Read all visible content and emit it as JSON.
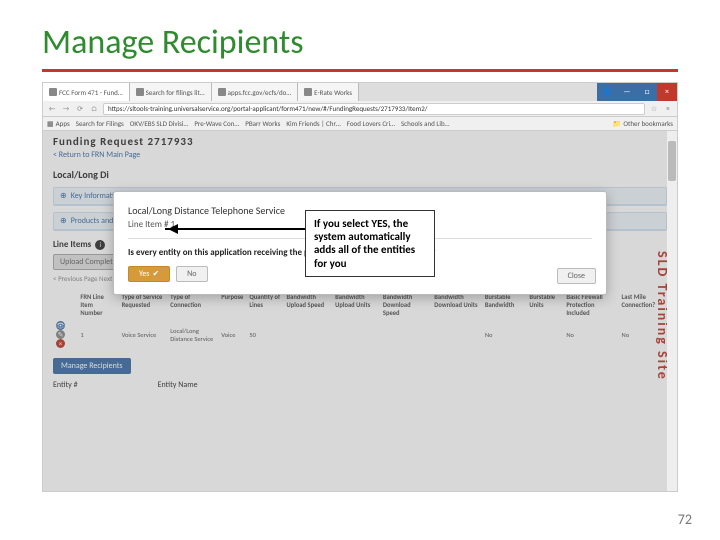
{
  "slide": {
    "title": "Manage Recipients",
    "page_num": "72"
  },
  "callout": {
    "text": "If you select YES, the system automatically adds all of the entities for you"
  },
  "browser": {
    "tabs": [
      "FCC Form 471 - Fund…",
      "Search for filings lit…",
      "apps.fcc.gov/ecfs/do…",
      "E-Rate Works"
    ],
    "url": "https://sltools-training.universalservice.org/portal-applicant/form471/new/#/FundingRequests/2717933/Item2/",
    "bookmarks": [
      "Apps",
      "Search for Filings",
      "OKV/EBS SLD Divisi…",
      "Pre-Wave Con…",
      "PBarr Works",
      "Kim Friends | Chr…",
      "Food Lovers Cri…",
      "Schools and Lib…"
    ],
    "other_bm": "Other bookmarks"
  },
  "page": {
    "funding_title": "Funding Request 2717933",
    "back_link": "< Return to FRN Main Page",
    "section": "Local/Long Di",
    "panel_key": "Key Information",
    "panel_prod": "Products and",
    "line_items": "Line Items",
    "upload": "Upload Completed",
    "pager": "< Previous Page   Next Page >",
    "manage_btn": "Manage Recipients",
    "entity_hdr1": "Entity #",
    "entity_hdr2": "Entity Name",
    "watermark": "SLD Training Site"
  },
  "table": {
    "headers": [
      "",
      "FRN Line Item Number",
      "Type of Service Requested",
      "Type of Connection",
      "Purpose",
      "Quantity of Lines",
      "Bandwidth Upload Speed",
      "Bandwidth Upload Units",
      "Bandwidth Download Speed",
      "Bandwidth Download Units",
      "Burstable Bandwidth",
      "Burstable Units",
      "Basic Firewall Protection Included",
      "Last Mile Connection?"
    ],
    "row": [
      "",
      "1",
      "Voice Service",
      "Local/Long Distance Service",
      "Voice",
      "50",
      "",
      "",
      "",
      "",
      "No",
      "",
      "No",
      "No"
    ]
  },
  "modal": {
    "title": "Local/Long Distance Telephone Service",
    "subtitle": "Line Item # 1",
    "question": "Is every entity on this application receiving the product or service in this line item?",
    "yes": "Yes",
    "no": "No",
    "close": "Close"
  }
}
